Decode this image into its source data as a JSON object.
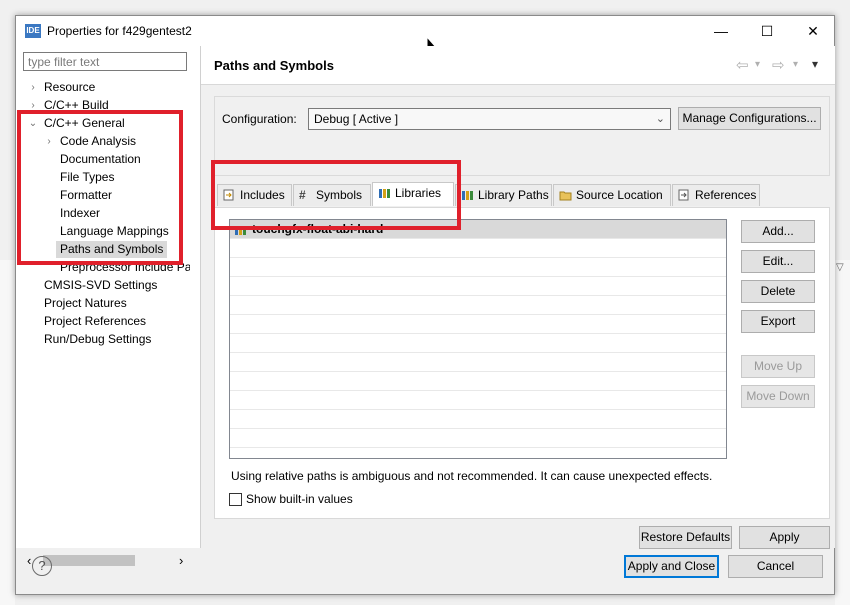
{
  "window": {
    "title": "Properties for f429gentest2",
    "icon_label": "IDE"
  },
  "titlebar_buttons": {
    "minimize": "—",
    "maximize": "☐",
    "close": "✕"
  },
  "filter": {
    "placeholder": "type filter text"
  },
  "tree": [
    {
      "label": "Resource",
      "expand": "›"
    },
    {
      "label": "C/C++ Build",
      "expand": "›"
    },
    {
      "label": "C/C++ General",
      "expand": "⌄"
    },
    {
      "label": "Code Analysis",
      "expand": "›"
    },
    {
      "label": "Documentation"
    },
    {
      "label": "File Types"
    },
    {
      "label": "Formatter"
    },
    {
      "label": "Indexer"
    },
    {
      "label": "Language Mappings"
    },
    {
      "label": "Paths and Symbols",
      "selected": true
    },
    {
      "label": "Preprocessor Include Pat"
    },
    {
      "label": "CMSIS-SVD Settings"
    },
    {
      "label": "Project Natures"
    },
    {
      "label": "Project References"
    },
    {
      "label": "Run/Debug Settings"
    }
  ],
  "scroll_arrows": {
    "left": "‹",
    "right": "›"
  },
  "page": {
    "title": "Paths and Symbols"
  },
  "nav_icons": {
    "back": "⇦",
    "forward": "⇨",
    "menu": "▾"
  },
  "config": {
    "label": "Configuration:",
    "value": "Debug  [ Active ]",
    "manage_label": "Manage Configurations..."
  },
  "tabs": [
    {
      "label": "Includes",
      "icon": "includes-icon"
    },
    {
      "label": "Symbols",
      "icon": "hash-icon"
    },
    {
      "label": "Libraries",
      "icon": "libraries-icon",
      "active": true
    },
    {
      "label": "Library Paths",
      "icon": "library-paths-icon"
    },
    {
      "label": "Source Location",
      "icon": "folder-icon"
    },
    {
      "label": "References",
      "icon": "references-icon"
    }
  ],
  "libraries": [
    "touchgfx-float-abi-hard"
  ],
  "side_buttons": {
    "add": "Add...",
    "edit": "Edit...",
    "delete": "Delete",
    "export": "Export",
    "move_up": "Move Up",
    "move_down": "Move Down"
  },
  "warning": "Using relative paths is ambiguous and not recommended. It can cause unexpected effects.",
  "show_builtin": {
    "label": "Show built-in values",
    "checked": false
  },
  "footer": {
    "restore_defaults": "Restore Defaults",
    "apply": "Apply",
    "apply_close": "Apply and Close",
    "cancel": "Cancel",
    "help": "?"
  },
  "colors": {
    "highlight_red": "#e0202b",
    "accent_blue": "#0078d7"
  }
}
